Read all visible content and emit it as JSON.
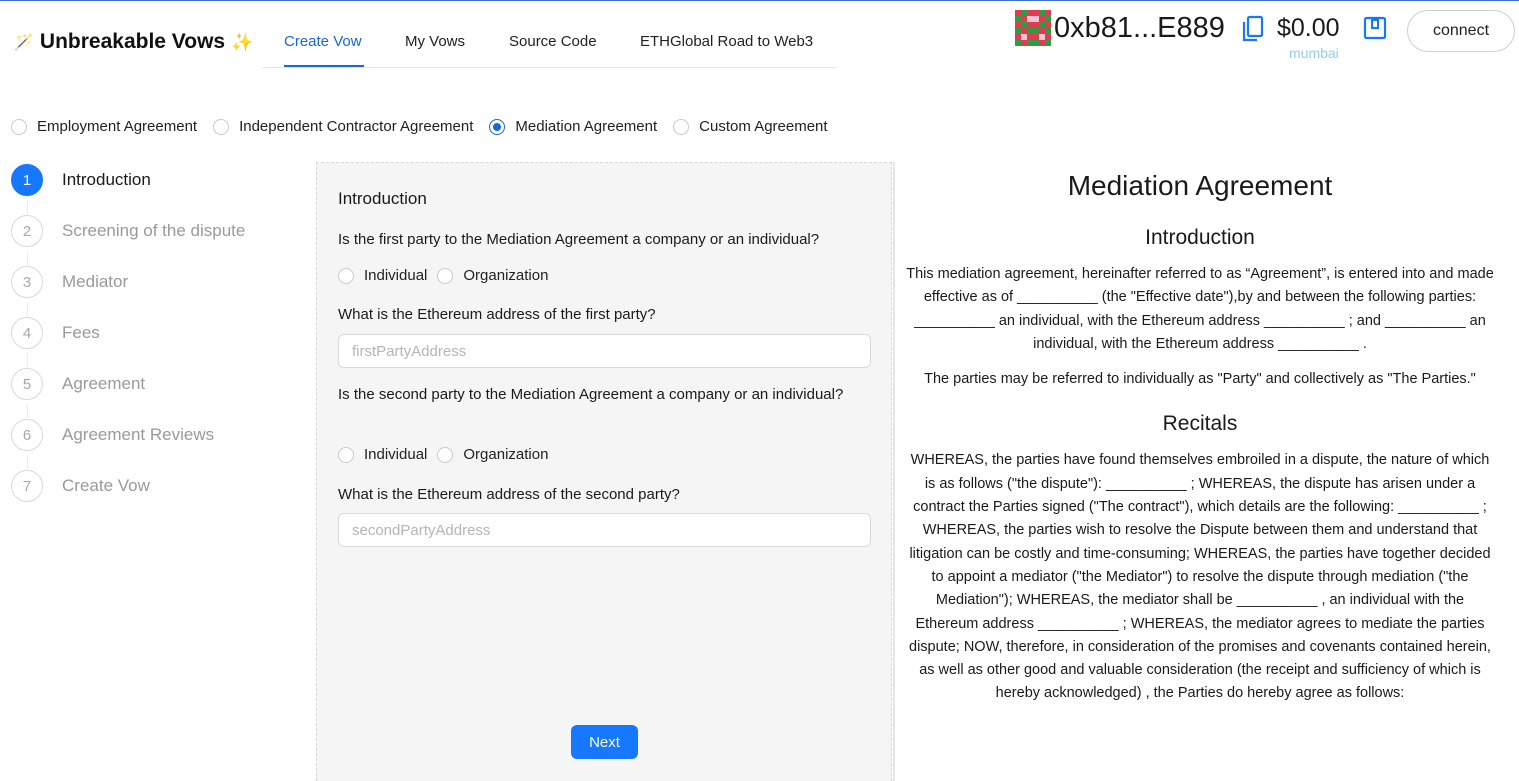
{
  "app": {
    "title": "Unbreakable Vows",
    "wand_glyph": "🪄",
    "sparkle_glyph": "✨"
  },
  "nav": {
    "tabs": [
      {
        "label": "Create Vow",
        "active": true
      },
      {
        "label": "My Vows",
        "active": false
      },
      {
        "label": "Source Code",
        "active": false
      },
      {
        "label": "ETHGlobal Road to Web3",
        "active": false
      }
    ]
  },
  "wallet": {
    "address": "0xb81...E889",
    "balance": "$0.00",
    "network": "mumbai",
    "connect_label": "connect",
    "icons": [
      "identicon-avatar",
      "copy-icon",
      "transaction-icon"
    ]
  },
  "agreement_types": {
    "options": [
      {
        "label": "Employment Agreement",
        "checked": false
      },
      {
        "label": "Independent Contractor Agreement",
        "checked": false
      },
      {
        "label": "Mediation Agreement",
        "checked": true
      },
      {
        "label": "Custom Agreement",
        "checked": false
      }
    ]
  },
  "steps": {
    "current": 1,
    "items": [
      {
        "num": "1",
        "label": "Introduction"
      },
      {
        "num": "2",
        "label": "Screening of the dispute"
      },
      {
        "num": "3",
        "label": "Mediator"
      },
      {
        "num": "4",
        "label": "Fees"
      },
      {
        "num": "5",
        "label": "Agreement"
      },
      {
        "num": "6",
        "label": "Agreement Reviews"
      },
      {
        "num": "7",
        "label": "Create Vow"
      }
    ]
  },
  "form": {
    "section_title": "Introduction",
    "q1": "Is the first party to the Mediation Agreement a company or an individual?",
    "q1_options": [
      "Individual",
      "Organization"
    ],
    "q2": "What is the Ethereum address of the first party?",
    "first_party_placeholder": "firstPartyAddress",
    "q3": "Is the second party to the Mediation Agreement a company or an individual?",
    "q3_options": [
      "Individual",
      "Organization"
    ],
    "q4": "What is the Ethereum address of the second party?",
    "second_party_placeholder": "secondPartyAddress",
    "next_label": "Next"
  },
  "document": {
    "title": "Mediation Agreement",
    "intro_heading": "Introduction",
    "intro_p1": "This mediation agreement, hereinafter referred to as “Agreement”, is entered into and made effective as of __________ (the \"Effective date\"),by and between the following parties: __________ an individual, with the Ethereum address __________ ; and __________ an individual, with the Ethereum address __________ .",
    "intro_p2": "The parties may be referred to individually as \"Party\" and collectively as \"The Parties.\"",
    "recitals_heading": "Recitals",
    "recitals_p": "WHEREAS, the parties have found themselves embroiled in a dispute, the nature of which is as follows (\"the dispute\"): __________ ; WHEREAS, the dispute has arisen under a contract the Parties signed (\"The contract\"), which details are the following: __________ ; WHEREAS, the parties wish to resolve the Dispute between them and understand that litigation can be costly and time-consuming; WHEREAS, the parties have together decided to appoint a mediator (\"the Mediator\") to resolve the dispute through mediation (\"the Mediation\"); WHEREAS, the mediator shall be __________ , an individual with the Ethereum address __________ ; WHEREAS, the mediator agrees to mediate the parties dispute; NOW, therefore, in consideration of the promises and covenants contained herein, as well as other good and valuable consideration (the receipt and sufficiency of which is hereby acknowledged) , the Parties do hereby agree as follows:"
  },
  "colors": {
    "accent": "#1677ff",
    "network": "#8fd0ee",
    "panel_bg": "#f5f5f5"
  }
}
